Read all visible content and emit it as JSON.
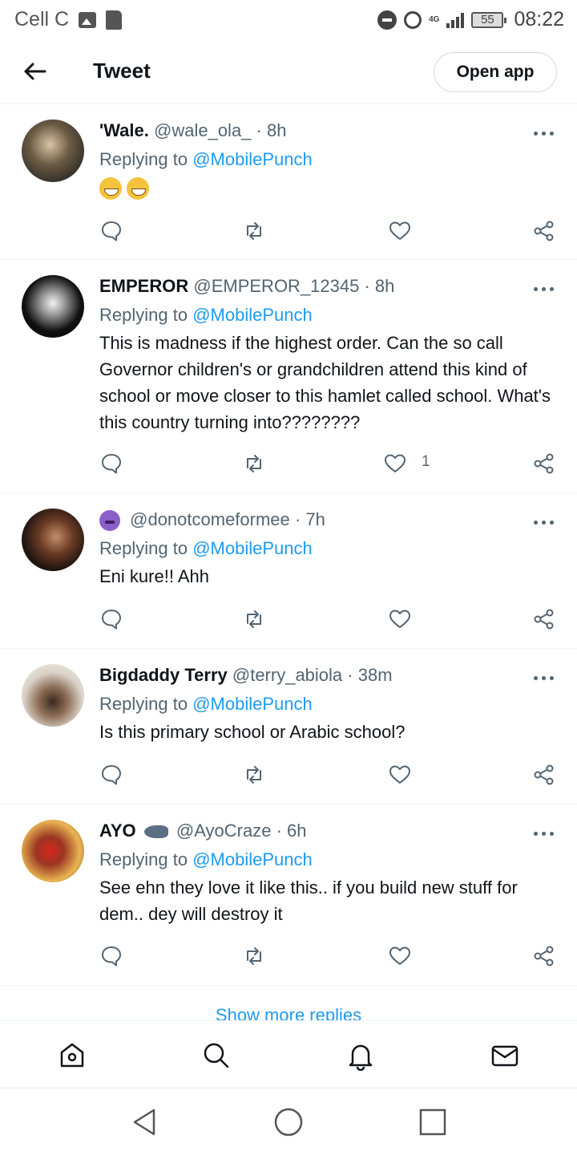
{
  "status_bar": {
    "carrier": "Cell C",
    "network": "4G",
    "battery": "55",
    "time": "08:22"
  },
  "header": {
    "title": "Tweet",
    "open_app": "Open app"
  },
  "tweets": [
    {
      "name": "'Wale.",
      "handle": "@wale_ola_",
      "time": "· 8h",
      "replying_prefix": "Replying to",
      "replying_to": "@MobilePunch",
      "text": "",
      "emojis": [
        "grin-icon",
        "grin-icon"
      ],
      "likes": ""
    },
    {
      "name": "EMPEROR",
      "handle": "@EMPEROR_12345",
      "time": "· 8h",
      "replying_prefix": "Replying to",
      "replying_to": "@MobilePunch",
      "text": "This is madness if the highest order. Can the so call Governor children's or grandchildren attend this kind of school or move closer to this hamlet called school. What's this country turning into????????",
      "likes": "1"
    },
    {
      "name": "",
      "handle": "@donotcomeformee",
      "time": "· 7h",
      "replying_prefix": "Replying to",
      "replying_to": "@MobilePunch",
      "text": "Eni kure!! Ahh",
      "likes": ""
    },
    {
      "name": "Bigdaddy Terry",
      "handle": "@terry_abiola",
      "time": "· 38m",
      "replying_prefix": "Replying to",
      "replying_to": "@MobilePunch",
      "text": "Is this primary school or Arabic school?",
      "likes": ""
    },
    {
      "name": "AYO",
      "handle": "@AyoCraze",
      "time": "· 6h",
      "replying_prefix": "Replying to",
      "replying_to": "@MobilePunch",
      "text": "See ehn they love it like this.. if you build new stuff for dem.. dey will destroy it",
      "likes": ""
    }
  ],
  "show_more": "Show more replies",
  "colors": {
    "accent": "#1d9bf0",
    "text": "#0f1419",
    "muted": "#536471",
    "divider": "#eff3f4"
  },
  "bottom_nav": [
    "home-icon",
    "search-icon",
    "notifications-icon",
    "messages-icon"
  ],
  "android_nav": [
    "back-triangle-icon",
    "home-circle-icon",
    "recents-square-icon"
  ]
}
